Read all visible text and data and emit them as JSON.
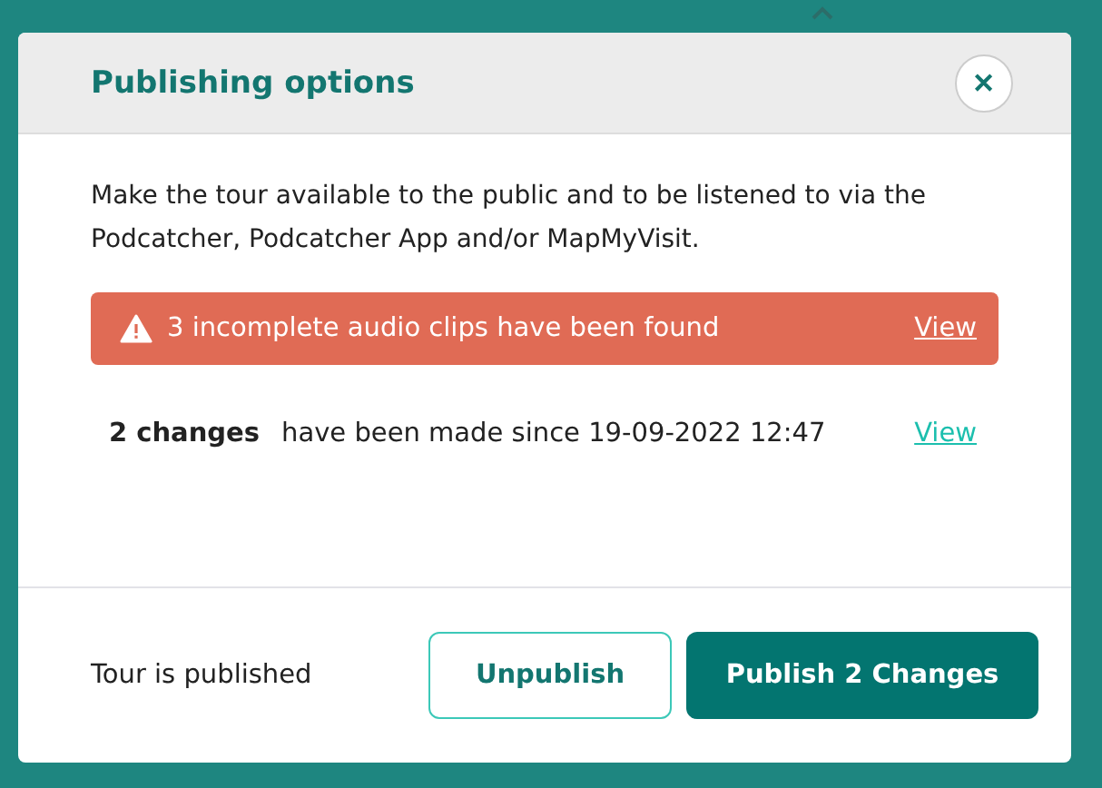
{
  "dialog": {
    "title": "Publishing options",
    "close": "✕",
    "description": "Make the tour available to the public and to be listened to via the Podcatcher, Podcatcher App and/or MapMyVisit.",
    "alert": {
      "text": "3 incomplete audio clips have been found",
      "link": "View"
    },
    "changes": {
      "count": "2 changes",
      "text": "have been made since 19-09-2022 12:47",
      "link": "View"
    },
    "footer": {
      "status": "Tour is published",
      "buttons": [
        {
          "label": "Unpublish",
          "kind": "secondary"
        },
        {
          "label": "Publish 2 Changes",
          "kind": "primary"
        }
      ]
    }
  }
}
